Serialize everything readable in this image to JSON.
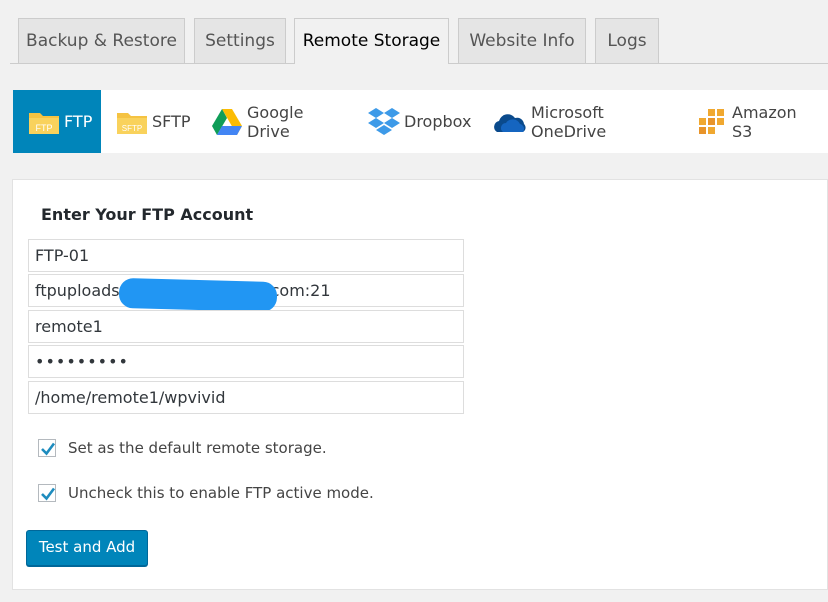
{
  "tabs": [
    {
      "label": "Backup & Restore",
      "active": false
    },
    {
      "label": "Settings",
      "active": false
    },
    {
      "label": "Remote Storage",
      "active": true
    },
    {
      "label": "Website Info",
      "active": false
    },
    {
      "label": "Logs",
      "active": false
    }
  ],
  "providers": [
    {
      "label": "FTP",
      "icon": "ftp-folder-icon",
      "icon_text": "FTP",
      "active": true
    },
    {
      "label": "SFTP",
      "icon": "sftp-folder-icon",
      "icon_text": "SFTP",
      "active": false
    },
    {
      "label": "Google Drive",
      "icon": "google-drive-icon",
      "active": false
    },
    {
      "label": "Dropbox",
      "icon": "dropbox-icon",
      "active": false
    },
    {
      "label": "Microsoft OneDrive",
      "icon": "onedrive-icon",
      "active": false
    },
    {
      "label": "Amazon S3",
      "icon": "amazon-s3-icon",
      "active": false
    }
  ],
  "form": {
    "title": "Enter Your FTP Account",
    "alias": "FTP-01",
    "server_prefix": "ftpuploads",
    "server_suffix": "com:21",
    "username": "remote1",
    "password": "•••••••••",
    "path": "/home/remote1/wpvivid",
    "default_storage_label": "Set as the default remote storage.",
    "default_storage_checked": true,
    "passive_mode_label": "Uncheck this to enable FTP active mode.",
    "passive_mode_checked": true,
    "submit_label": "Test and Add"
  },
  "colors": {
    "accent": "#0085ba",
    "checkmark": "#1e8cbe",
    "folder": "#f5c342",
    "redaction": "#2196f3"
  }
}
